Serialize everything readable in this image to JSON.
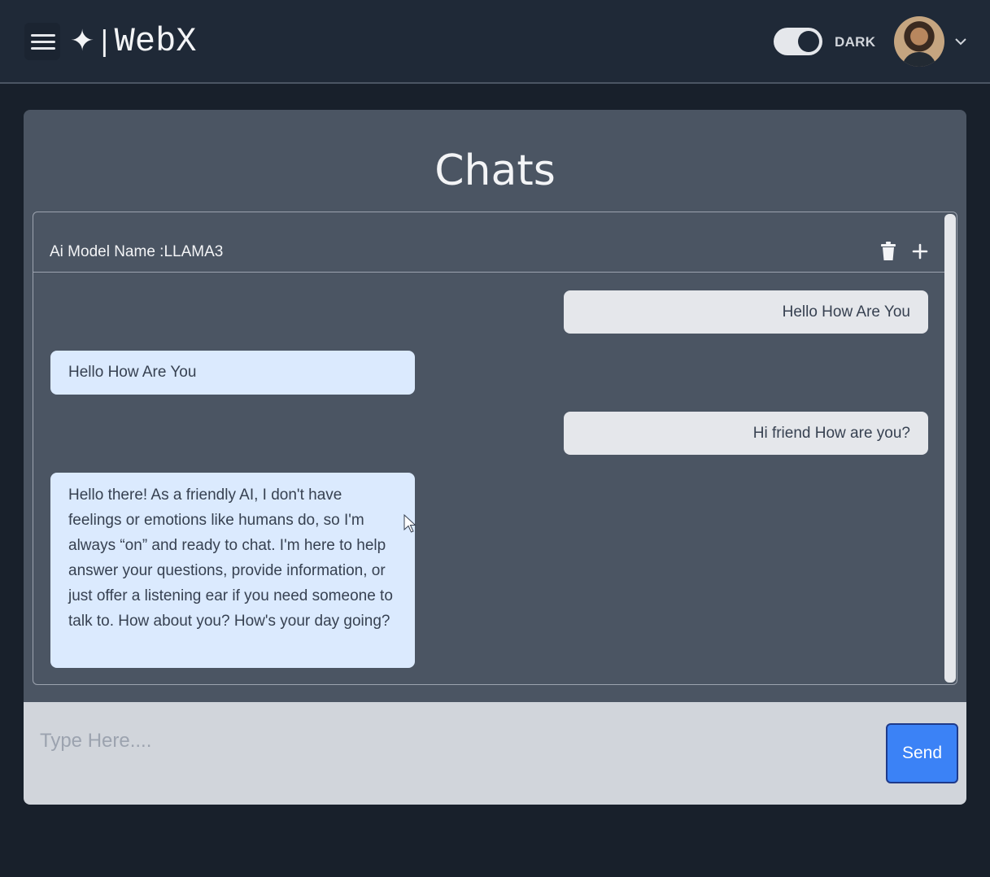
{
  "header": {
    "menu_icon": "hamburger-menu-icon",
    "logo_symbol": "✦",
    "logo_separator": "|",
    "logo_text": "WebX",
    "theme_toggle_state": "on",
    "theme_label": "DARK",
    "avatar_icon": "user-avatar",
    "dropdown_icon": "chevron-down-icon"
  },
  "page": {
    "title": "Chats"
  },
  "chat": {
    "model_label": "Ai Model Name :LLAMA3",
    "actions": [
      {
        "name": "delete",
        "icon": "trash-icon"
      },
      {
        "name": "new",
        "icon": "plus-icon"
      }
    ],
    "messages": [
      {
        "role": "user",
        "text": "Hello How Are You"
      },
      {
        "role": "assistant",
        "text": "Hello How Are You"
      },
      {
        "role": "user",
        "text": "Hi friend How are you?"
      },
      {
        "role": "assistant",
        "text": "Hello there! As a friendly AI, I don't have feelings or emotions like humans do, so I'm always “on” and ready to chat. I'm here to help answer your questions, provide information, or just offer a listening ear if you need someone to talk to. How about you? How's your day going?"
      }
    ]
  },
  "composer": {
    "placeholder": "Type Here....",
    "value": "",
    "send_label": "Send"
  },
  "colors": {
    "background": "#18202b",
    "topbar": "#1f2937",
    "card": "#4b5563",
    "user_bubble": "#e5e7eb",
    "assistant_bubble": "#dbeafe",
    "send_button": "#3b82f6"
  }
}
